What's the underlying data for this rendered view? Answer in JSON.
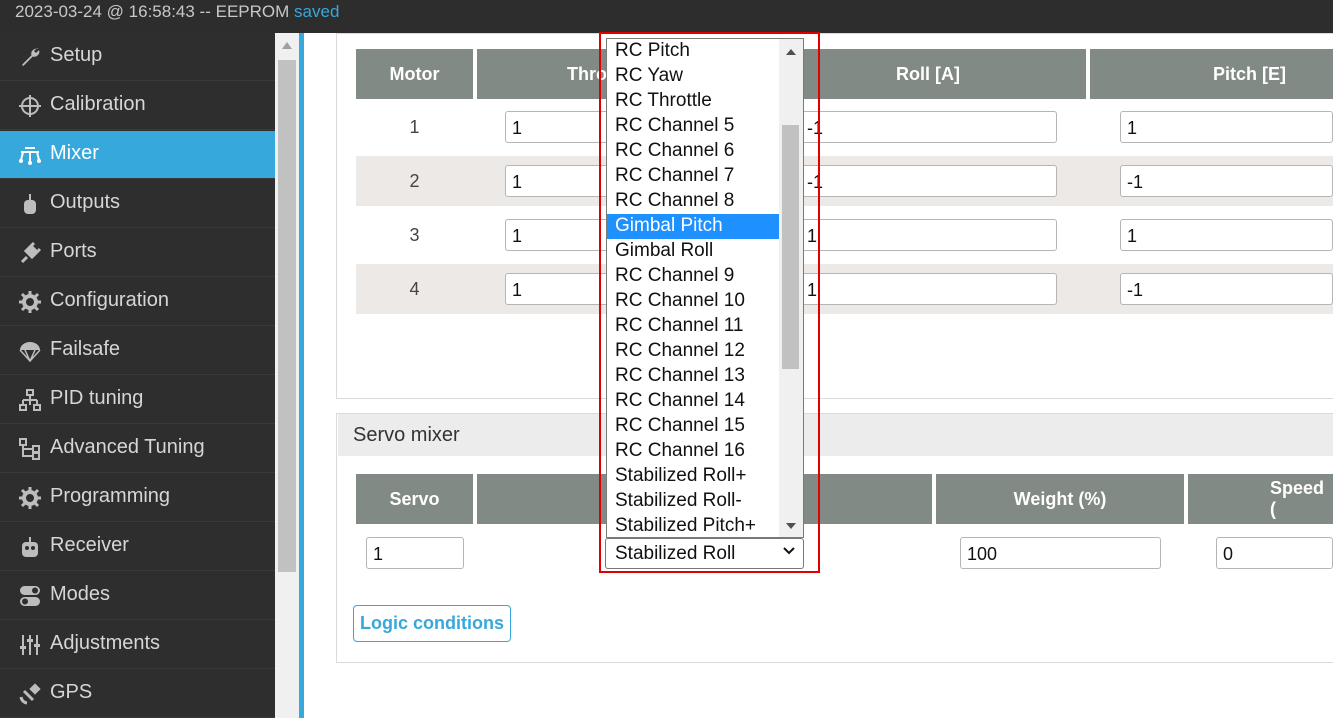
{
  "status": {
    "datetime": "2023-03-24 @ 16:58:43 -- EEPROM",
    "state": "saved"
  },
  "sidebar": {
    "items": [
      {
        "label": "Setup",
        "icon": "wrench-icon"
      },
      {
        "label": "Calibration",
        "icon": "crosshair-icon"
      },
      {
        "label": "Mixer",
        "icon": "mixer-icon",
        "active": true
      },
      {
        "label": "Outputs",
        "icon": "motor-icon"
      },
      {
        "label": "Ports",
        "icon": "plug-icon"
      },
      {
        "label": "Configuration",
        "icon": "gear-icon"
      },
      {
        "label": "Failsafe",
        "icon": "parachute-icon"
      },
      {
        "label": "PID tuning",
        "icon": "tree-icon"
      },
      {
        "label": "Advanced Tuning",
        "icon": "flow-icon"
      },
      {
        "label": "Programming",
        "icon": "gear-icon"
      },
      {
        "label": "Receiver",
        "icon": "robot-icon"
      },
      {
        "label": "Modes",
        "icon": "toggle-icon"
      },
      {
        "label": "Adjustments",
        "icon": "sliders-icon"
      },
      {
        "label": "GPS",
        "icon": "satellite-icon"
      }
    ]
  },
  "motor_mixer": {
    "headers": [
      "Motor",
      "Thro",
      "Roll [A]",
      "Pitch [E]"
    ],
    "rows": [
      {
        "motor": "1",
        "throttle": "1",
        "roll": "-1",
        "pitch": "1"
      },
      {
        "motor": "2",
        "throttle": "1",
        "roll": "-1",
        "pitch": "-1"
      },
      {
        "motor": "3",
        "throttle": "1",
        "roll": "1",
        "pitch": "1"
      },
      {
        "motor": "4",
        "throttle": "1",
        "roll": "1",
        "pitch": "-1"
      }
    ]
  },
  "servo_mixer": {
    "title": "Servo mixer",
    "headers": [
      "Servo",
      "",
      "Weight (%)",
      "Speed ("
    ],
    "row": {
      "servo": "1",
      "source": "Stabilized Roll",
      "weight": "100",
      "speed": "0"
    },
    "logic_button": "Logic conditions"
  },
  "dropdown": {
    "options": [
      "RC Pitch",
      "RC Yaw",
      "RC Throttle",
      "RC Channel 5",
      "RC Channel 6",
      "RC Channel 7",
      "RC Channel 8",
      "Gimbal Pitch",
      "Gimbal Roll",
      "RC Channel 9",
      "RC Channel 10",
      "RC Channel 11",
      "RC Channel 12",
      "RC Channel 13",
      "RC Channel 14",
      "RC Channel 15",
      "RC Channel 16",
      "Stabilized Roll+",
      "Stabilized Roll-",
      "Stabilized Pitch+"
    ],
    "highlighted": "Gimbal Pitch"
  },
  "colors": {
    "accent": "#37a8db",
    "sidebar": "#2e2e2e",
    "header": "#828a85",
    "highlight": "#e00000",
    "selection": "#1e90ff"
  }
}
